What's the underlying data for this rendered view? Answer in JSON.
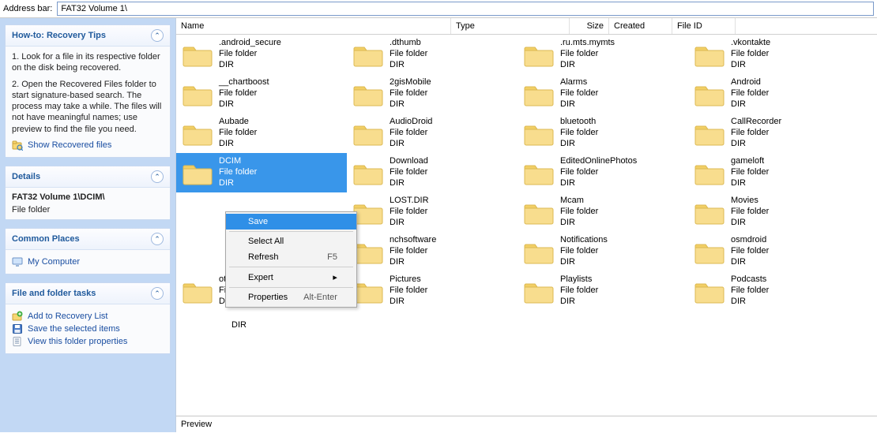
{
  "address": {
    "label": "Address bar:",
    "value": "FAT32 Volume 1\\"
  },
  "sidebar": {
    "tips": {
      "title": "How-to: Recovery Tips",
      "p1": "1. Look for a file in its respective folder on the disk being recovered.",
      "p2": "2. Open the Recovered Files folder to start signature-based search. The process may take a while. The files will not have meaningful names; use preview to find the file you need.",
      "link": "Show Recovered files"
    },
    "details": {
      "title": "Details",
      "path": "FAT32 Volume 1\\DCIM\\",
      "type": "File folder"
    },
    "common": {
      "title": "Common Places",
      "link": "My Computer"
    },
    "tasks": {
      "title": "File and folder tasks",
      "add": "Add to Recovery List",
      "save": "Save the selected items",
      "props": "View this folder properties"
    }
  },
  "headers": {
    "name": "Name",
    "type": "Type",
    "size": "Size",
    "created": "Created",
    "fileid": "File ID"
  },
  "folders": [
    [
      ".android_secure",
      ".dthumb",
      ".ru.mts.mymts",
      ".vkontakte"
    ],
    [
      "__chartboost",
      "2gisMobile",
      "Alarms",
      "Android"
    ],
    [
      "Aubade",
      "AudioDroid",
      "bluetooth",
      "CallRecorder"
    ],
    [
      "DCIM",
      "Download",
      "EditedOnlinePhotos",
      "gameloft"
    ],
    [
      "",
      "LOST.DIR",
      "Mcam",
      "Movies"
    ],
    [
      "",
      "nchsoftware",
      "Notifications",
      "osmdroid"
    ],
    [
      "otaLogs",
      "Pictures",
      "Playlists",
      "Podcasts"
    ]
  ],
  "folder_meta": {
    "type": "File folder",
    "ext": "DIR"
  },
  "selected": "DCIM",
  "context_menu": {
    "save": "Save",
    "select_all": "Select All",
    "refresh": "Refresh",
    "refresh_shortcut": "F5",
    "expert": "Expert",
    "properties": "Properties",
    "props_shortcut": "Alt-Enter"
  },
  "preview": {
    "label": "Preview"
  }
}
